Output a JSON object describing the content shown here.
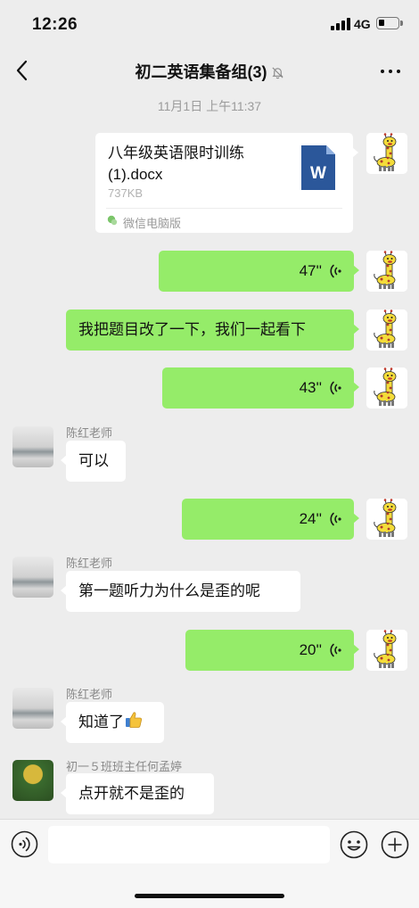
{
  "status_bar": {
    "time": "12:26",
    "network": "4G",
    "battery_level": 0.3
  },
  "nav": {
    "title": "初二英语集备组(3)",
    "muted": true
  },
  "timestamp": "11月1日 上午11:37",
  "file_message": {
    "file_name": "八年级英语限时训练(1).docx",
    "file_size": "737KB",
    "file_type_icon_label": "W",
    "source": "微信电脑版"
  },
  "messages": {
    "voice_1": {
      "duration": "47''"
    },
    "text_1": {
      "text": "我把题目改了一下，我们一起看下"
    },
    "voice_2": {
      "duration": "43''"
    },
    "reply_1": {
      "sender": "陈红老师",
      "text": "可以"
    },
    "voice_3": {
      "duration": "24''"
    },
    "reply_2": {
      "sender": "陈红老师",
      "text": "第一题听力为什么是歪的呢"
    },
    "voice_4": {
      "duration": "20''"
    },
    "reply_3": {
      "sender": "陈红老师",
      "text": "知道了"
    },
    "reply_4": {
      "sender": "初一５班班主任何孟婷",
      "text": "点开就不是歪的"
    }
  },
  "input": {
    "value": "",
    "placeholder": ""
  },
  "colors": {
    "background": "#ededed",
    "outgoing_bubble": "#95ec69",
    "incoming_bubble": "#ffffff",
    "word_icon": "#2b579a"
  }
}
